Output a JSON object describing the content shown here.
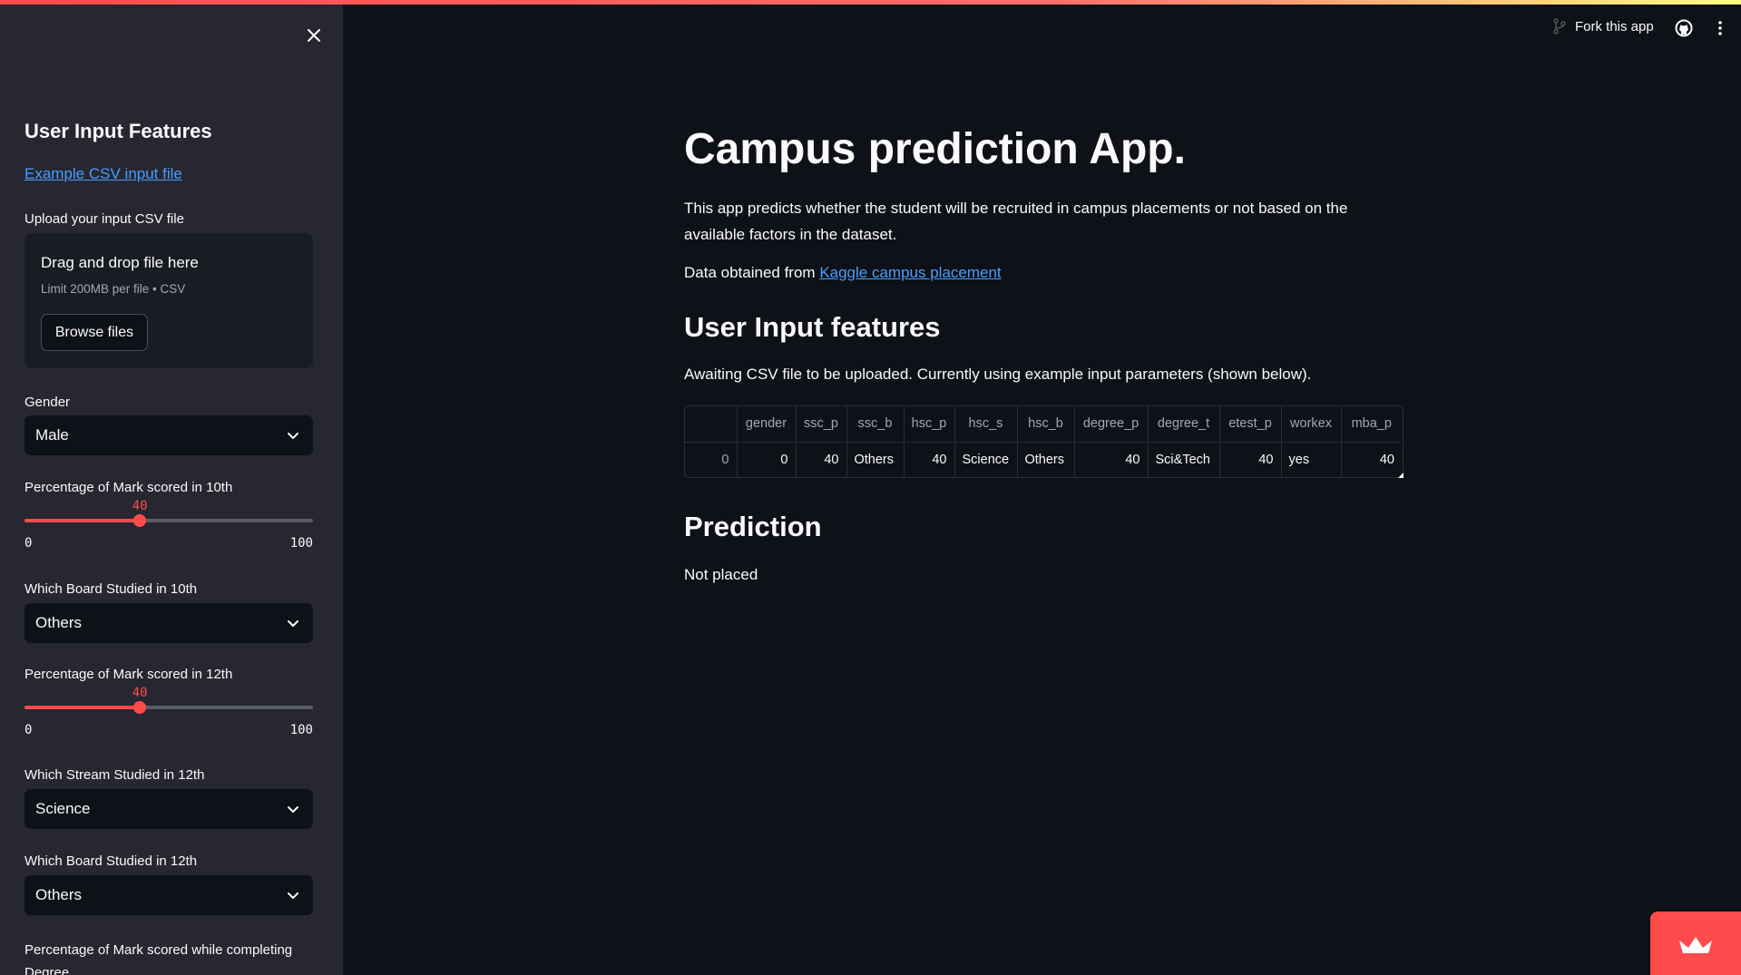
{
  "header": {
    "fork_label": "Fork this app",
    "accent": "#ff4b4b"
  },
  "sidebar": {
    "title": "User Input Features",
    "example_link": "Example CSV input file",
    "upload_label": "Upload your input CSV file",
    "uploader": {
      "title": "Drag and drop file here",
      "subtitle": "Limit 200MB per file • CSV",
      "browse_label": "Browse files"
    },
    "gender": {
      "label": "Gender",
      "value": "Male"
    },
    "ssc_p": {
      "label": "Percentage of Mark scored in 10th",
      "value": "40",
      "min": "0",
      "max": "100",
      "fraction": 0.4
    },
    "ssc_b": {
      "label": "Which Board Studied in 10th",
      "value": "Others"
    },
    "hsc_p": {
      "label": "Percentage of Mark scored in 12th",
      "value": "40",
      "min": "0",
      "max": "100",
      "fraction": 0.4
    },
    "hsc_s": {
      "label": "Which Stream Studied in 12th",
      "value": "Science"
    },
    "hsc_b": {
      "label": "Which Board Studied in 12th",
      "value": "Others"
    },
    "degree_p": {
      "label": "Percentage of Mark scored while completing Degree"
    }
  },
  "main": {
    "title": "Campus prediction App.",
    "description": "This app predicts whether the student will be recruited in campus placements or not based on the available factors in the dataset.",
    "source_prefix": "Data obtained from ",
    "source_link": "Kaggle campus placement",
    "features_heading": "User Input features",
    "awaiting_text": "Awaiting CSV file to be uploaded. Currently using example input parameters (shown below).",
    "table": {
      "columns": [
        "",
        "gender",
        "ssc_p",
        "ssc_b",
        "hsc_p",
        "hsc_s",
        "hsc_b",
        "degree_p",
        "degree_t",
        "etest_p",
        "workex",
        "mba_p"
      ],
      "rows": [
        [
          "0",
          "0",
          "40",
          "Others",
          "40",
          "Science",
          "Others",
          "40",
          "Sci&Tech",
          "40",
          "yes",
          "40"
        ]
      ]
    },
    "prediction_heading": "Prediction",
    "prediction_value": "Not placed"
  }
}
